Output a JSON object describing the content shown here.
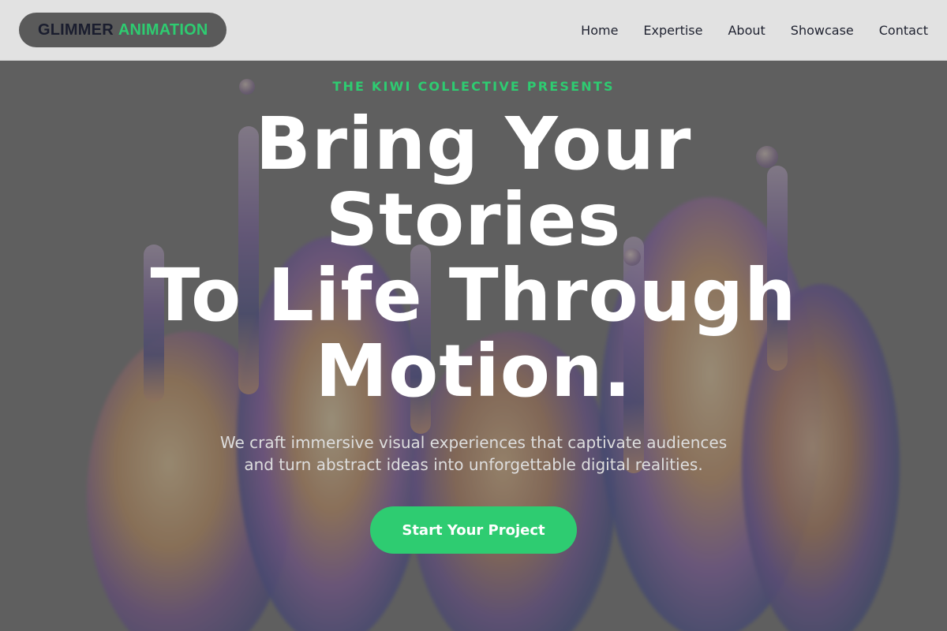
{
  "header": {
    "logo": {
      "word1": "GLIMMER",
      "word2": "ANIMATION"
    },
    "nav": [
      "Home",
      "Expertise",
      "About",
      "Showcase",
      "Contact"
    ]
  },
  "hero": {
    "eyebrow": "THE KIWI COLLECTIVE PRESENTS",
    "headline_lines": [
      "Bring Your",
      "Stories",
      "To Life Through",
      "Motion."
    ],
    "subtext_lines": [
      "We craft immersive visual experiences that captivate audiences",
      "and turn abstract ideas into unforgettable digital realities."
    ],
    "cta_label": "Start Your Project"
  },
  "colors": {
    "accent": "#2ecc71",
    "header_bg": "#e2e2e2",
    "logo_bg": "#5a5a5a",
    "text_dark": "#1f2230"
  }
}
